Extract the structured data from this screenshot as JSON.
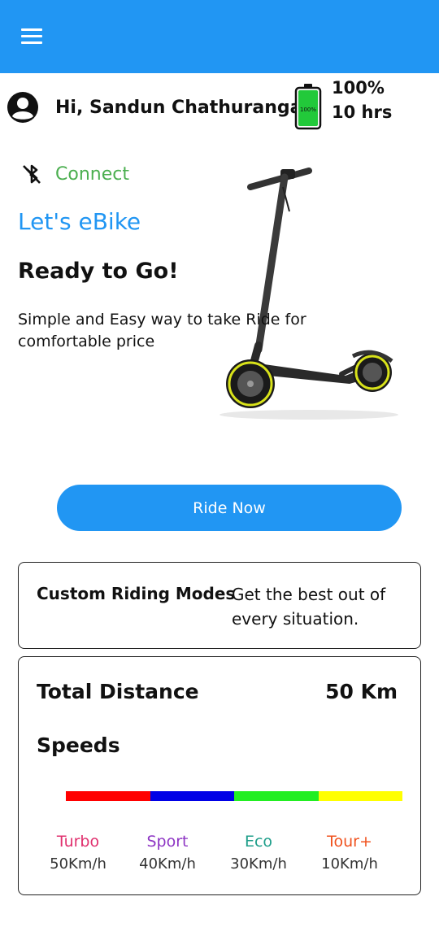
{
  "user": {
    "greeting": "Hi, Sandun Chathuranga"
  },
  "battery": {
    "percent": "100%",
    "hours": "10 hrs",
    "icon_label": "100%",
    "level": 1.0,
    "fill_color": "#22C93A"
  },
  "connect": {
    "label": "Connect",
    "icon": "bluetooth-disabled-icon"
  },
  "hero": {
    "brand": "Let's eBike",
    "headline": "Ready to Go!",
    "tagline": "Simple and Easy way to take Ride for comfortable price"
  },
  "ride_button": {
    "label": "Ride Now"
  },
  "modes_card": {
    "title": "Custom Riding Modes",
    "description": "Get the best out of every situation."
  },
  "stats": {
    "distance_label": "Total Distance",
    "distance_value": "50 Km",
    "speeds_label": "Speeds",
    "bar_colors": [
      "#FF0000",
      "#0000E6",
      "#22EE22",
      "#FFFF00"
    ],
    "modes": [
      {
        "name": "Turbo",
        "speed": "50Km/h",
        "color": "#E0306E"
      },
      {
        "name": "Sport",
        "speed": "40Km/h",
        "color": "#8E36C4"
      },
      {
        "name": "Eco",
        "speed": "30Km/h",
        "color": "#1E9E8A"
      },
      {
        "name": "Tour+",
        "speed": "10Km/h",
        "color": "#F0521E"
      }
    ]
  },
  "colors": {
    "primary": "#2196F3",
    "connect_green": "#4CAF50"
  }
}
